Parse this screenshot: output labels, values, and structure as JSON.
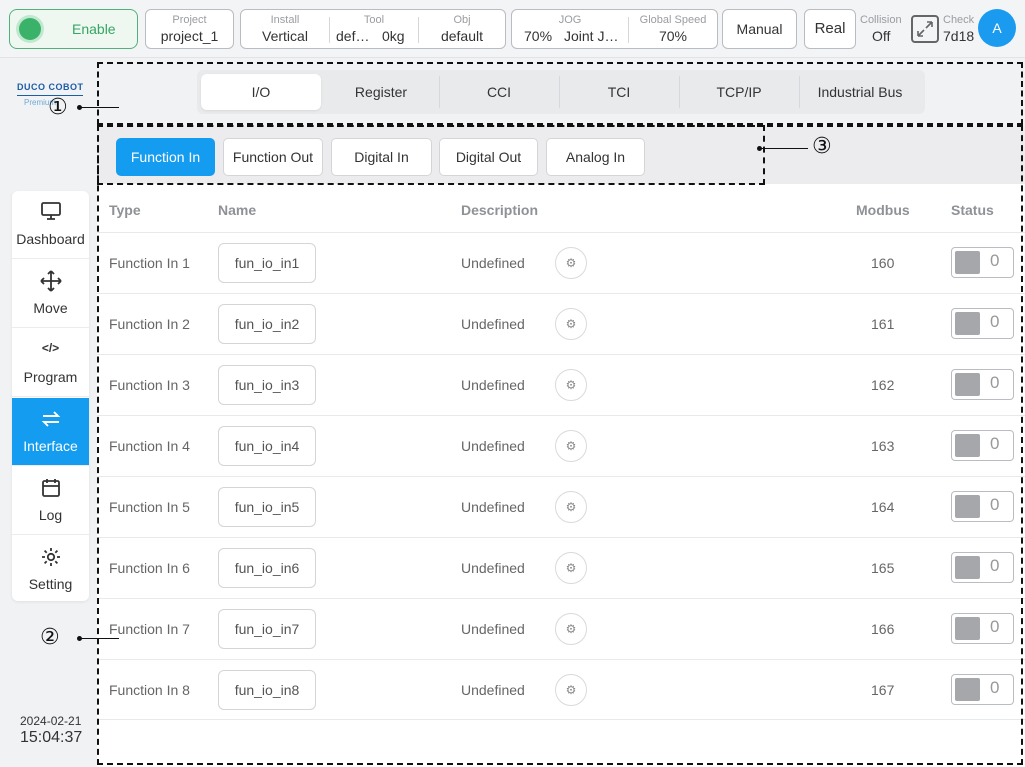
{
  "topbar": {
    "enable_label": "Enable",
    "project": {
      "caption": "Project",
      "value": "project_1"
    },
    "install": {
      "caption": "Install",
      "value": "Vertical"
    },
    "tool": {
      "caption": "Tool",
      "value1": "def…",
      "value2": "0kg"
    },
    "obj": {
      "caption": "Obj",
      "value": "default"
    },
    "jog": {
      "caption": "JOG",
      "value1": "70%",
      "value2": "Joint J…"
    },
    "global_speed": {
      "caption": "Global Speed",
      "value": "70%"
    },
    "mode_label": "Manual",
    "real_label": "Real",
    "collision": {
      "caption": "Collision",
      "value": "Off"
    },
    "check": {
      "caption": "Check",
      "value": "7d18"
    },
    "avatar_letter": "A"
  },
  "sidebar": {
    "logo_text": "DUCO COBOT",
    "logo_sub": "Premium",
    "items": [
      {
        "label": "Dashboard",
        "icon": "monitor-icon"
      },
      {
        "label": "Move",
        "icon": "move-icon"
      },
      {
        "label": "Program",
        "icon": "code-icon"
      },
      {
        "label": "Interface",
        "icon": "exchange-icon",
        "active": true
      },
      {
        "label": "Log",
        "icon": "calendar-icon"
      },
      {
        "label": "Setting",
        "icon": "gear-icon"
      }
    ],
    "date": "2024-02-21",
    "time": "15:04:37"
  },
  "main": {
    "tabs": [
      "I/O",
      "Register",
      "CCI",
      "TCI",
      "TCP/IP",
      "Industrial Bus"
    ],
    "active_tab": "I/O",
    "subtabs": [
      "Function In",
      "Function Out",
      "Digital In",
      "Digital Out",
      "Analog In"
    ],
    "active_subtab": "Function In",
    "columns": {
      "type": "Type",
      "name": "Name",
      "description": "Description",
      "modbus": "Modbus",
      "status": "Status"
    },
    "rows": [
      {
        "type": "Function In 1",
        "name": "fun_io_in1",
        "description": "Undefined",
        "modbus": "160",
        "status": "0"
      },
      {
        "type": "Function In 2",
        "name": "fun_io_in2",
        "description": "Undefined",
        "modbus": "161",
        "status": "0"
      },
      {
        "type": "Function In 3",
        "name": "fun_io_in3",
        "description": "Undefined",
        "modbus": "162",
        "status": "0"
      },
      {
        "type": "Function In 4",
        "name": "fun_io_in4",
        "description": "Undefined",
        "modbus": "163",
        "status": "0"
      },
      {
        "type": "Function In 5",
        "name": "fun_io_in5",
        "description": "Undefined",
        "modbus": "164",
        "status": "0"
      },
      {
        "type": "Function In 6",
        "name": "fun_io_in6",
        "description": "Undefined",
        "modbus": "165",
        "status": "0"
      },
      {
        "type": "Function In 7",
        "name": "fun_io_in7",
        "description": "Undefined",
        "modbus": "166",
        "status": "0"
      },
      {
        "type": "Function In 8",
        "name": "fun_io_in8",
        "description": "Undefined",
        "modbus": "167",
        "status": "0"
      }
    ]
  },
  "annotations": {
    "callout1": "①",
    "callout2": "②",
    "callout3": "③"
  }
}
